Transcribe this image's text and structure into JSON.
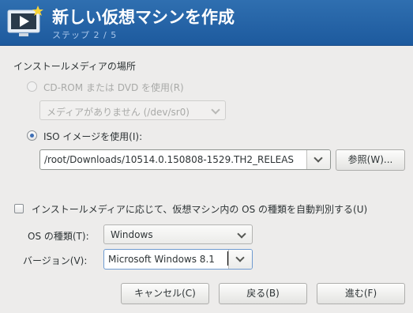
{
  "header": {
    "title": "新しい仮想マシンを作成",
    "step": "ステップ 2 / 5",
    "icon": "monitor-play-icon"
  },
  "media": {
    "section_label": "インストールメディアの場所",
    "cdrom_label": "CD-ROM または DVD を使用(R)",
    "cdrom_combo_value": "メディアがありません (/dev/sr0)",
    "iso_label": "ISO イメージを使用(I):",
    "iso_path": "/root/Downloads/10514.0.150808-1529.TH2_RELEAS",
    "browse_label": "参照(W)..."
  },
  "os_detect": {
    "auto_label": "インストールメディアに応じて、仮想マシン内の OS の種類を自動判別する(U)",
    "auto_checked": false,
    "os_type_label": "OS の種類(T):",
    "os_type_value": "Windows",
    "version_label": "バージョン(V):",
    "version_value": "Microsoft Windows 8.1"
  },
  "footer": {
    "cancel_label": "キャンセル(C)",
    "back_label": "戻る(B)",
    "forward_label": "進む(F)"
  },
  "colors": {
    "header_bg": "#2566a8",
    "header_title": "#ffffff",
    "header_step": "#a9c6ea",
    "radio_accent": "#3f6fb5",
    "window_bg": "#edeceb"
  }
}
